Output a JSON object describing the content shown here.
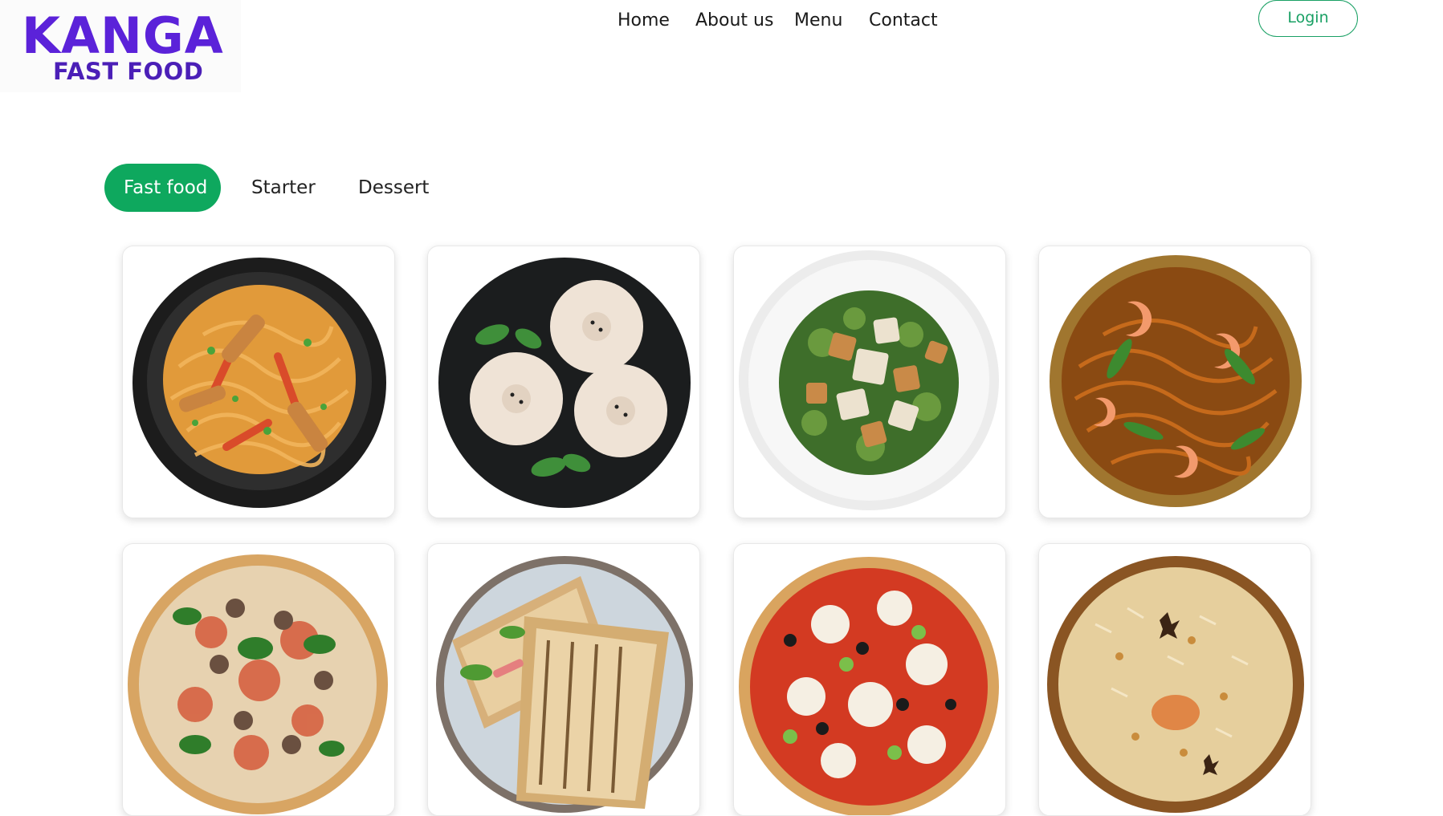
{
  "logo": {
    "brand": "KANGA",
    "tagline": "FAST FOOD"
  },
  "nav": {
    "items": [
      "Home",
      "About us",
      "Menu",
      "Contact"
    ]
  },
  "auth": {
    "login_label": "Login"
  },
  "categories": {
    "tabs": [
      "Fast food",
      "Starter",
      "Dessert"
    ],
    "active": "Fast food"
  },
  "menu_items": [
    {
      "icon": "noodles-icon"
    },
    {
      "icon": "dumplings-icon"
    },
    {
      "icon": "salad-icon"
    },
    {
      "icon": "shrimp-noodles-icon"
    },
    {
      "icon": "pizza-icon"
    },
    {
      "icon": "sandwich-icon"
    },
    {
      "icon": "pizza-icon"
    },
    {
      "icon": "biryani-icon"
    }
  ],
  "colors": {
    "brand_purple": "#5b22d9",
    "accent_green": "#0ea85e",
    "login_border": "#19a064"
  }
}
